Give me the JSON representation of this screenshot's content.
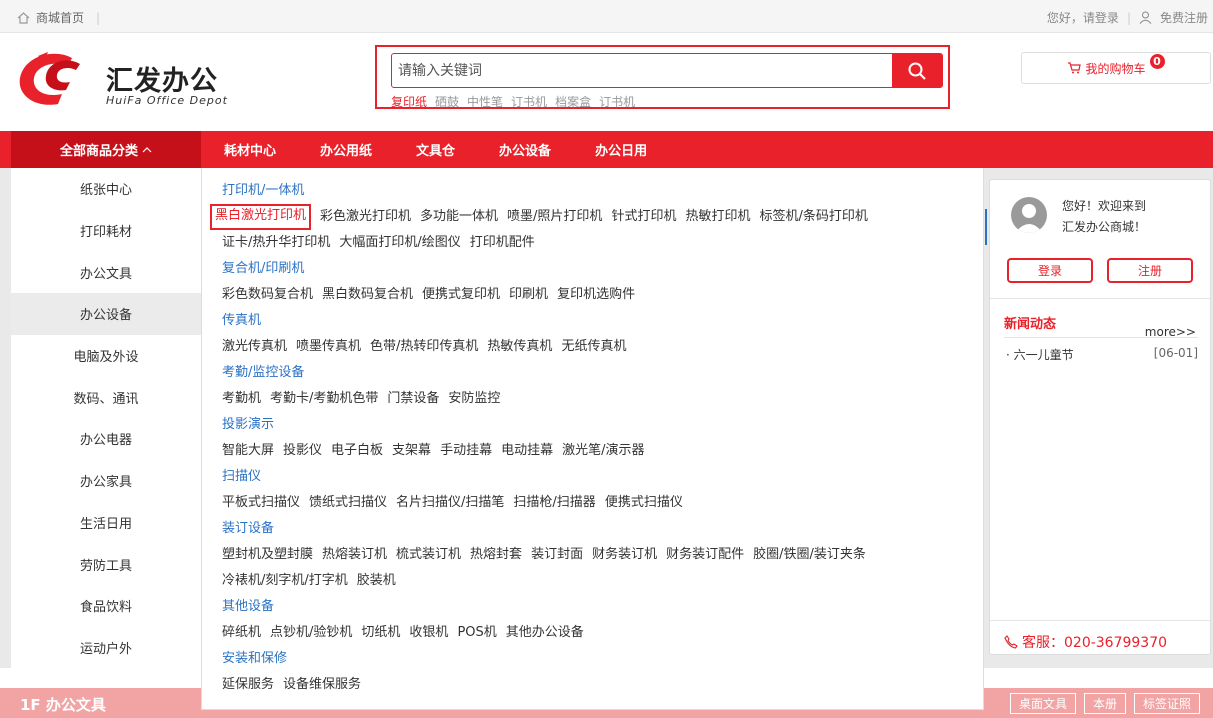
{
  "topbar": {
    "home_label": "商城首页",
    "greeting": "您好，",
    "login_link": "请登录",
    "register_link": "免费注册"
  },
  "logo": {
    "name_cn": "汇发办公",
    "name_en": "HuiFa Office Depot"
  },
  "search": {
    "placeholder": "请输入关键词",
    "hot_words": [
      "复印纸",
      "硒鼓",
      "中性笔",
      "订书机",
      "档案盒",
      "订书机"
    ]
  },
  "cart": {
    "label": "我的购物车",
    "count": "0"
  },
  "nav": {
    "all_categories": "全部商品分类",
    "links": [
      "耗材中心",
      "办公用纸",
      "文具仓",
      "办公设备",
      "办公日用"
    ]
  },
  "side_categories": [
    "纸张中心",
    "打印耗材",
    "办公文具",
    "办公设备",
    "电脑及外设",
    "数码、通讯",
    "办公电器",
    "办公家具",
    "生活日用",
    "劳防工具",
    "食品饮料",
    "运动户外"
  ],
  "side_active_index": 3,
  "dropdown": [
    {
      "title": "打印机/一体机",
      "items": [
        "黑白激光打印机",
        "彩色激光打印机",
        "多功能一体机",
        "喷墨/照片打印机",
        "针式打印机",
        "热敏打印机",
        "标签机/条码打印机",
        "证卡/热升华打印机",
        "大幅面打印机/绘图仪",
        "打印机配件"
      ]
    },
    {
      "title": "复合机/印刷机",
      "items": [
        "彩色数码复合机",
        "黑白数码复合机",
        "便携式复印机",
        "印刷机",
        "复印机选购件"
      ]
    },
    {
      "title": "传真机",
      "items": [
        "激光传真机",
        "喷墨传真机",
        "色带/热转印传真机",
        "热敏传真机",
        "无纸传真机"
      ]
    },
    {
      "title": "考勤/监控设备",
      "items": [
        "考勤机",
        "考勤卡/考勤机色带",
        "门禁设备",
        "安防监控"
      ]
    },
    {
      "title": "投影演示",
      "items": [
        "智能大屏",
        "投影仪",
        "电子白板",
        "支架幕",
        "手动挂幕",
        "电动挂幕",
        "激光笔/演示器"
      ]
    },
    {
      "title": "扫描仪",
      "items": [
        "平板式扫描仪",
        "馈纸式扫描仪",
        "名片扫描仪/扫描笔",
        "扫描枪/扫描器",
        "便携式扫描仪"
      ]
    },
    {
      "title": "装订设备",
      "items": [
        "塑封机及塑封膜",
        "热熔装订机",
        "梳式装订机",
        "热熔封套",
        "装订封面",
        "财务装订机",
        "财务装订配件",
        "胶圈/铁圈/装订夹条",
        "冷裱机/刻字机/打字机",
        "胶装机"
      ]
    },
    {
      "title": "其他设备",
      "items": [
        "碎纸机",
        "点钞机/验钞机",
        "切纸机",
        "收银机",
        "POS机",
        "其他办公设备"
      ]
    },
    {
      "title": "安装和保修",
      "items": [
        "延保服务",
        "设备维保服务"
      ]
    }
  ],
  "selected_item": "黑白激光打印机",
  "user_panel": {
    "welcome_line1": "您好！欢迎来到",
    "welcome_line2": "汇发办公商城！",
    "login_button": "登录",
    "register_button": "注册",
    "news_title": "新闻动态",
    "more": "more>>",
    "news": [
      {
        "title": "六一儿童节",
        "date": "[06-01]"
      }
    ],
    "service": "客服：020-36799370"
  },
  "floor": {
    "title": "1F 办公文具",
    "buttons": [
      "桌面文具",
      "本册",
      "标签证照"
    ]
  },
  "colors": {
    "brand_red": "#e8212a",
    "link_blue": "#2b72c4"
  }
}
